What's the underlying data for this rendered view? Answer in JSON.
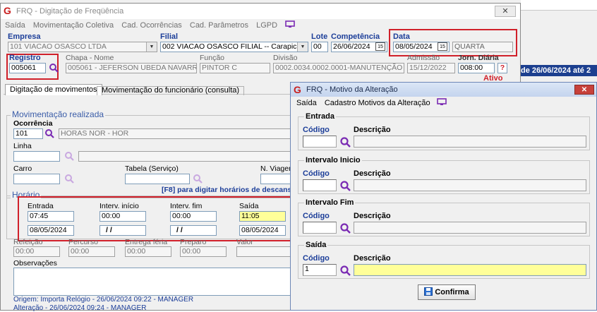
{
  "background": {
    "banner_text": "de 26/06/2024 até 2"
  },
  "main_window": {
    "title": "FRQ - Digitação de Freqüência",
    "close_glyph": "✕",
    "menu": [
      "Saída",
      "Movimentação Coletiva",
      "Cad. Ocorrências",
      "Cad. Parâmetros",
      "LGPD"
    ],
    "empresa": {
      "label": "Empresa",
      "value": "101 VIACAO OSASCO LTDA"
    },
    "filial": {
      "label": "Filial",
      "value": "002 VIACAO OSASCO FILIAL -- Carapicuiba"
    },
    "lote": {
      "label": "Lote",
      "value": "00"
    },
    "competencia": {
      "label": "Competência",
      "value": "26/06/2024"
    },
    "data": {
      "label": "Data",
      "value": "08/05/2024",
      "weekday": "QUARTA"
    },
    "registro": {
      "label": "Registro",
      "value": "005061"
    },
    "chapa_nome": {
      "label": "Chapa - Nome",
      "value": "005061 - JEFERSON UBEDA NAVARRO"
    },
    "funcao": {
      "label": "Função",
      "value": "PINTOR C"
    },
    "divisao": {
      "label": "Divisão",
      "value": "0002.0034.0002.0001-MANUTENÇÃO"
    },
    "admissao": {
      "label": "Admissão",
      "value": "15/12/2022"
    },
    "jorn_diaria": {
      "label": "Jorn. Diária",
      "value": "008:00",
      "help": "?"
    },
    "status": "Ativo",
    "tabs": [
      "Digitação de movimentos",
      "Movimentação do funcionário (consulta)"
    ],
    "mov_section": "Movimentação realizada",
    "ocorrencia": {
      "label": "Ocorrência",
      "code": "101",
      "desc": "HORAS NOR - HOR"
    },
    "linha": {
      "label": "Linha"
    },
    "carro": {
      "label": "Carro"
    },
    "tabela": {
      "label": "Tabela (Serviço)"
    },
    "n_viagem": {
      "label": "N. Viagem"
    },
    "hint": "[F8] para digitar horários de descanso",
    "horario_section": "Horário",
    "horario": {
      "entrada": {
        "label": "Entrada",
        "time": "07:45",
        "date": "08/05/2024"
      },
      "interv_inicio": {
        "label": "Interv. início",
        "time": "00:00",
        "date": "/ /"
      },
      "interv_fim": {
        "label": "Interv. fim",
        "time": "00:00",
        "date": "/ /"
      },
      "saida": {
        "label": "Saída",
        "time": "11:05",
        "date": "08/05/2024"
      }
    },
    "refeicao": {
      "label": "Refeição",
      "value": "00:00"
    },
    "percurso": {
      "label": "Percurso",
      "value": "00:00"
    },
    "entrega_feria": {
      "label": "Entrega féria",
      "value": "00:00"
    },
    "preparo": {
      "label": "Preparo",
      "value": "00:00"
    },
    "valor": {
      "label": "Valor"
    },
    "observacoes": {
      "label": "Observações"
    },
    "origem": "Origem: Importa Relógio - 26/06/2024 09:22 - MANAGER",
    "alteracao": "Alteração - 26/06/2024 09:24 - MANAGER"
  },
  "dialog": {
    "title": "FRQ - Motivo da Alteração",
    "close_glyph": "✕",
    "menu": [
      "Saída",
      "Cadastro Motivos da Alteração"
    ],
    "groups": [
      {
        "title": "Entrada",
        "codigo_label": "Código",
        "descricao_label": "Descrição",
        "codigo": "",
        "descricao": ""
      },
      {
        "title": "Intervalo Inicio",
        "codigo_label": "Código",
        "descricao_label": "Descrição",
        "codigo": "",
        "descricao": ""
      },
      {
        "title": "Intervalo Fim",
        "codigo_label": "Código",
        "descricao_label": "Descrição",
        "codigo": "",
        "descricao": ""
      },
      {
        "title": "Saída",
        "codigo_label": "Código",
        "descricao_label": "Descrição",
        "codigo": "1",
        "descricao": ""
      }
    ],
    "confirm_label": "Confirma"
  },
  "colors": {
    "accent_blue": "#1c3e99",
    "highlight_red": "#d0202a",
    "yellow_field": "#ffff99",
    "purple_icon": "#7a2bb3"
  }
}
